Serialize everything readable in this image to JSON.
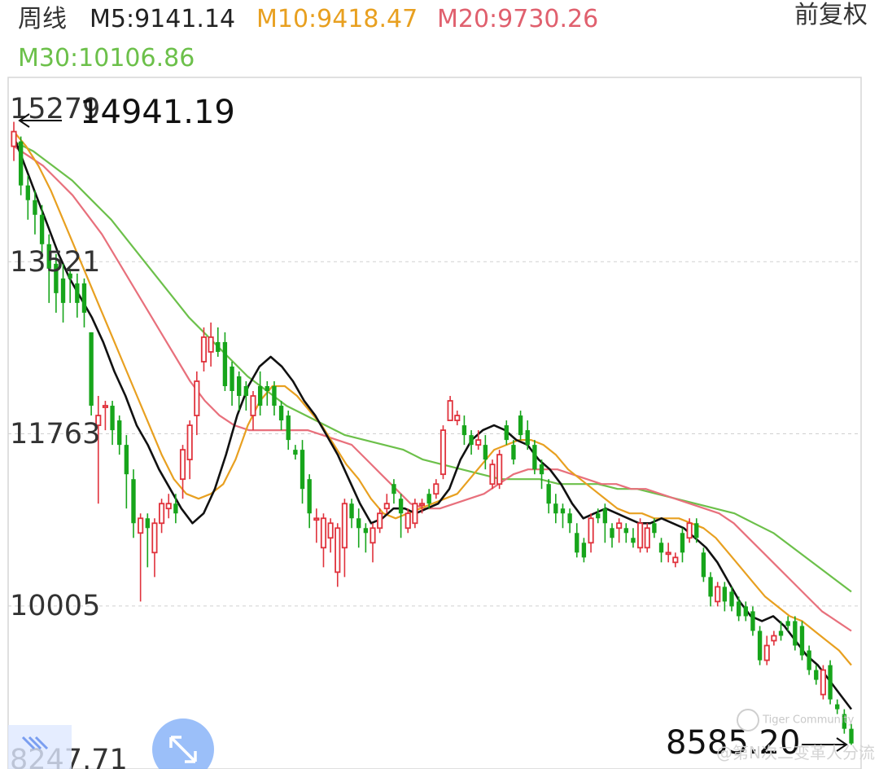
{
  "header": {
    "period": "周线",
    "ma5": "M5:9141.14",
    "ma10": "M10:9418.47",
    "ma20": "M20:9730.26",
    "ma30": "M30:10106.86",
    "adjust": "前复权"
  },
  "watermark": {
    "brand": "Tiger Community",
    "user": "@第N次二变革人分流"
  },
  "colors": {
    "up": "#e0323c",
    "down": "#17a51b",
    "ma5": "#111111",
    "ma10": "#e8a020",
    "ma20": "#e8707c",
    "ma30": "#6cc04a",
    "grid": "#d0d0d0",
    "text": "#333333"
  },
  "icons": {
    "expand": "expand-arrows-icon",
    "shrink": "shrink-arrows-icon"
  },
  "chart_data": {
    "type": "candlestick",
    "ylim": [
      8247.71,
      15279
    ],
    "y_ticks": [
      "15279",
      "13521",
      "11763",
      "10005",
      "8247.71"
    ],
    "y_tick_values": [
      15279,
      13521,
      11763,
      10005,
      8247.71
    ],
    "max_label": "14941.19",
    "min_label": "8585.20",
    "grid": true,
    "candles": [
      [
        14700,
        14850,
        14950,
        14550
      ],
      [
        14750,
        14300,
        14800,
        14200
      ],
      [
        14300,
        14150,
        14400,
        13950
      ],
      [
        14150,
        14000,
        14250,
        13800
      ],
      [
        14000,
        13700,
        14100,
        13550
      ],
      [
        13700,
        13450,
        13800,
        13100
      ],
      [
        13500,
        13200,
        13600,
        13000
      ],
      [
        13350,
        13100,
        13500,
        12900
      ],
      [
        13400,
        13350,
        13450,
        13100
      ],
      [
        13300,
        13100,
        13400,
        12950
      ],
      [
        13300,
        13000,
        13350,
        12850
      ],
      [
        12800,
        12050,
        12800,
        11950
      ],
      [
        11850,
        11950,
        12150,
        11050
      ],
      [
        12050,
        12050,
        12100,
        11800
      ],
      [
        12050,
        11800,
        12100,
        11650
      ],
      [
        11900,
        11650,
        11950,
        11550
      ],
      [
        11650,
        11350,
        11750,
        11000
      ],
      [
        11300,
        10850,
        11400,
        10700
      ],
      [
        10750,
        10900,
        10950,
        10050
      ],
      [
        10900,
        10800,
        10950,
        10400
      ],
      [
        10550,
        10850,
        10900,
        10300
      ],
      [
        10850,
        11050,
        11100,
        10750
      ],
      [
        11000,
        11050,
        11150,
        10900
      ],
      [
        11050,
        10950,
        11150,
        10850
      ],
      [
        11300,
        11600,
        11650,
        11100
      ],
      [
        11500,
        11850,
        11900,
        11300
      ],
      [
        11950,
        12300,
        12400,
        11750
      ],
      [
        12500,
        12750,
        12850,
        12400
      ],
      [
        12600,
        12750,
        12900,
        12450
      ],
      [
        12700,
        12600,
        12850,
        12550
      ],
      [
        12700,
        12250,
        12800,
        12200
      ],
      [
        12450,
        12200,
        12500,
        12050
      ],
      [
        12350,
        12150,
        12400,
        12000
      ],
      [
        12250,
        12150,
        12300,
        12000
      ],
      [
        11950,
        12150,
        12200,
        11800
      ],
      [
        12250,
        12050,
        12400,
        11950
      ],
      [
        12250,
        12200,
        12300,
        12050
      ],
      [
        12250,
        12050,
        12300,
        11950
      ],
      [
        12050,
        11900,
        12100,
        11800
      ],
      [
        11950,
        11700,
        12000,
        11600
      ],
      [
        11600,
        11550,
        11650,
        11500
      ],
      [
        11600,
        11200,
        11700,
        11050
      ],
      [
        11300,
        10950,
        11350,
        10800
      ],
      [
        10900,
        10900,
        11000,
        10650
      ],
      [
        10600,
        10900,
        10950,
        10400
      ],
      [
        10700,
        10850,
        10900,
        10550
      ],
      [
        10350,
        10800,
        10850,
        10200
      ],
      [
        10600,
        11050,
        11100,
        10300
      ],
      [
        11050,
        10900,
        11100,
        10800
      ],
      [
        10900,
        10800,
        11000,
        10600
      ],
      [
        10800,
        10750,
        10850,
        10550
      ],
      [
        10650,
        10800,
        10850,
        10450
      ],
      [
        10800,
        10950,
        11000,
        10750
      ],
      [
        11000,
        11050,
        11150,
        10950
      ],
      [
        11250,
        11150,
        11300,
        11050
      ],
      [
        11100,
        10950,
        11150,
        10700
      ],
      [
        10800,
        10950,
        11000,
        10750
      ],
      [
        10850,
        11050,
        11100,
        10800
      ],
      [
        11050,
        11050,
        11100,
        10950
      ],
      [
        11150,
        11050,
        11200,
        11000
      ],
      [
        11150,
        11250,
        11300,
        11100
      ],
      [
        11350,
        11800,
        11850,
        11300
      ],
      [
        11900,
        12100,
        12150,
        11900
      ],
      [
        11900,
        11950,
        12000,
        11850
      ],
      [
        11850,
        11750,
        11950,
        11650
      ],
      [
        11750,
        11650,
        11800,
        11550
      ],
      [
        11650,
        11700,
        11800,
        11600
      ],
      [
        11650,
        11500,
        11750,
        11400
      ],
      [
        11250,
        11450,
        11500,
        11200
      ],
      [
        11250,
        11550,
        11600,
        11200
      ],
      [
        11850,
        11700,
        11900,
        11650
      ],
      [
        11650,
        11500,
        11700,
        11450
      ],
      [
        11950,
        11750,
        12000,
        11700
      ],
      [
        11800,
        11650,
        11900,
        11600
      ],
      [
        11650,
        11400,
        11700,
        11350
      ],
      [
        11450,
        11350,
        11500,
        11200
      ],
      [
        11250,
        11050,
        11300,
        10950
      ],
      [
        11050,
        10950,
        11150,
        10850
      ],
      [
        11000,
        10950,
        11050,
        10800
      ],
      [
        10950,
        10850,
        11000,
        10750
      ],
      [
        10750,
        10550,
        10850,
        10500
      ],
      [
        10650,
        10500,
        10700,
        10450
      ],
      [
        10650,
        10900,
        10950,
        10550
      ],
      [
        10950,
        10900,
        11000,
        10850
      ],
      [
        11000,
        10850,
        11050,
        10650
      ],
      [
        10800,
        10700,
        10850,
        10600
      ],
      [
        10800,
        10850,
        10900,
        10650
      ],
      [
        10800,
        10750,
        10850,
        10650
      ],
      [
        10700,
        10650,
        10800,
        10600
      ],
      [
        10600,
        10850,
        10900,
        10550
      ],
      [
        10600,
        10800,
        10850,
        10550
      ],
      [
        10850,
        10750,
        10900,
        10700
      ],
      [
        10650,
        10550,
        10700,
        10450
      ],
      [
        10550,
        10550,
        10650,
        10450
      ],
      [
        10450,
        10500,
        10550,
        10400
      ],
      [
        10750,
        10550,
        10800,
        10450
      ],
      [
        10700,
        10850,
        10900,
        10650
      ],
      [
        10850,
        10700,
        10900,
        10650
      ],
      [
        10550,
        10300,
        10600,
        10250
      ],
      [
        10300,
        10100,
        10350,
        10000
      ],
      [
        10050,
        10200,
        10250,
        10000
      ],
      [
        10200,
        10050,
        10250,
        9950
      ],
      [
        10150,
        10000,
        10200,
        9950
      ],
      [
        10050,
        9900,
        10100,
        9850
      ],
      [
        10000,
        9900,
        10050,
        9850
      ],
      [
        9950,
        9750,
        10000,
        9700
      ],
      [
        9750,
        9450,
        9800,
        9400
      ],
      [
        9450,
        9600,
        9700,
        9400
      ],
      [
        9650,
        9700,
        9750,
        9600
      ],
      [
        9750,
        9700,
        9850,
        9650
      ],
      [
        9850,
        9800,
        9900,
        9750
      ],
      [
        9850,
        9600,
        9900,
        9550
      ],
      [
        9800,
        9500,
        9850,
        9450
      ],
      [
        9550,
        9350,
        9600,
        9300
      ],
      [
        9350,
        9250,
        9400,
        9200
      ],
      [
        9100,
        9350,
        9400,
        9050
      ],
      [
        9400,
        9050,
        9450,
        9000
      ],
      [
        9000,
        8950,
        9050,
        8900
      ],
      [
        8900,
        8750,
        8950,
        8700
      ],
      [
        8750,
        8600,
        8800,
        8585.2
      ]
    ],
    "series": [
      {
        "name": "M5",
        "values": [
          14800,
          14500,
          14200,
          13900,
          13600,
          13350,
          13150,
          12950,
          12700,
          12400,
          12150,
          11850,
          11650,
          11400,
          11200,
          11000,
          10850,
          10950,
          11200,
          11550,
          11950,
          12250,
          12450,
          12550,
          12450,
          12300,
          12100,
          11950,
          11750,
          11550,
          11300,
          11050,
          10850,
          10900,
          11000,
          11000,
          10950,
          11000,
          11050,
          11200,
          11500,
          11700,
          11800,
          11850,
          11800,
          11700,
          11650,
          11500,
          11400,
          11250,
          11050,
          10900,
          10950,
          11000,
          10950,
          10900,
          10850,
          10850,
          10900,
          10850,
          10800,
          10700,
          10600,
          10450,
          10250,
          10050,
          9900,
          9850,
          9900,
          9800,
          9650,
          9500,
          9400,
          9250,
          9100,
          8950
        ]
      },
      {
        "name": "M10",
        "values": [
          14850,
          14700,
          14500,
          14250,
          13950,
          13650,
          13350,
          13050,
          12750,
          12450,
          12150,
          11850,
          11550,
          11300,
          11150,
          11100,
          11150,
          11250,
          11500,
          11850,
          12100,
          12250,
          12250,
          12150,
          12000,
          11850,
          11650,
          11450,
          11300,
          11100,
          10950,
          10900,
          10950,
          11000,
          11050,
          11100,
          11150,
          11300,
          11450,
          11600,
          11650,
          11700,
          11700,
          11650,
          11550,
          11400,
          11300,
          11200,
          11100,
          11000,
          10950,
          10950,
          10900,
          10900,
          10900,
          10850,
          10800,
          10700,
          10550,
          10400,
          10250,
          10100,
          10000,
          9900,
          9850,
          9750,
          9650,
          9550,
          9400
        ]
      },
      {
        "name": "M20",
        "values": [
          14700,
          14600,
          14500,
          14350,
          14200,
          14000,
          13800,
          13550,
          13300,
          13050,
          12800,
          12550,
          12300,
          12100,
          11950,
          11850,
          11800,
          11800,
          11800,
          11800,
          11800,
          11750,
          11700,
          11650,
          11500,
          11350,
          11200,
          11050,
          11000,
          11000,
          11050,
          11100,
          11150,
          11250,
          11350,
          11400,
          11400,
          11400,
          11350,
          11300,
          11250,
          11250,
          11200,
          11200,
          11150,
          11100,
          11050,
          11000,
          10950,
          10850,
          10700,
          10550,
          10400,
          10250,
          10100,
          9950,
          9850,
          9750
        ]
      },
      {
        "name": "M30",
        "values": [
          14750,
          14650,
          14500,
          14350,
          14150,
          13950,
          13700,
          13450,
          13200,
          12950,
          12750,
          12550,
          12350,
          12200,
          12050,
          11950,
          11850,
          11750,
          11700,
          11650,
          11600,
          11500,
          11450,
          11400,
          11350,
          11300,
          11300,
          11300,
          11250,
          11250,
          11250,
          11200,
          11200,
          11150,
          11100,
          11050,
          11000,
          10950,
          10850,
          10750,
          10600,
          10450,
          10300,
          10150
        ]
      }
    ]
  }
}
